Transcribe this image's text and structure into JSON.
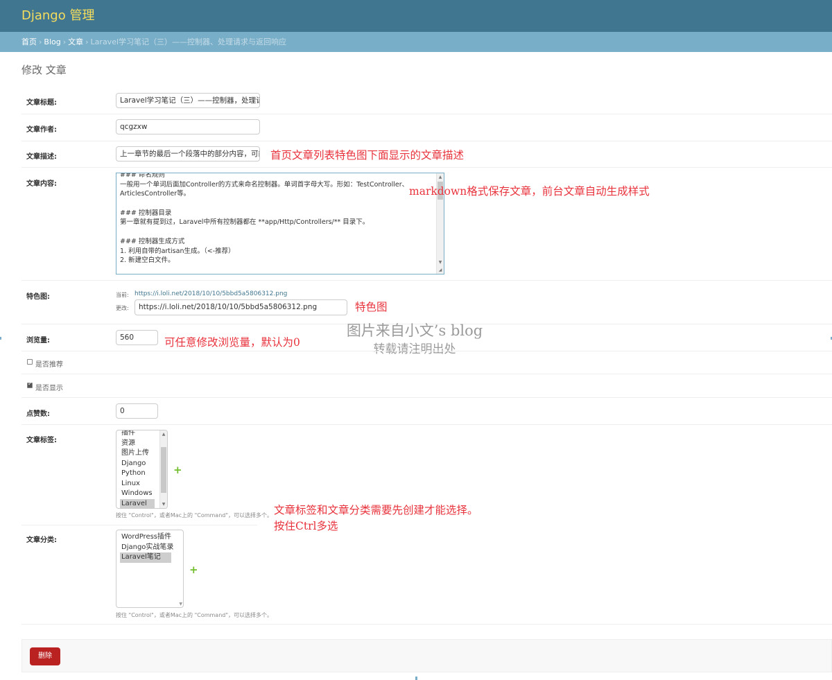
{
  "header": {
    "site_name": "Django 管理"
  },
  "breadcrumbs": {
    "home": "首页",
    "app": "Blog",
    "model": "文章",
    "current": "Laravel学习笔记（三）——控制器、处理请求与返回响应",
    "separator": "›"
  },
  "page": {
    "title": "修改 文章"
  },
  "fields": {
    "title": {
      "label": "文章标题:",
      "value": "Laravel学习笔记（三）——控制器，处理请求"
    },
    "author": {
      "label": "文章作者:",
      "value": "qcgzxw"
    },
    "description": {
      "label": "文章描述:",
      "value": "上一章节的最后一个段落中的部分内容，可能"
    },
    "content": {
      "label": "文章内容:",
      "lines": [
        "### 命名规则",
        "一般用一个单词后面加Controller的方式来命名控制器。单词首字母大写。形如：TestController、",
        "ArticlesController等。",
        "",
        "### 控制器目录",
        "第一章就有提到过，Laravel中所有控制器都在 **app/Http/Controllers/** 目录下。",
        "",
        "### 控制器生成方式",
        "1. 利用自带的artisan生成。（<-推荐）",
        "2. 新建空白文件。"
      ]
    },
    "image": {
      "label": "特色图:",
      "current_label": "当前:",
      "current_url": "https://i.loli.net/2018/10/10/5bbd5a5806312.png",
      "change_label": "更改:",
      "value": "https://i.loli.net/2018/10/10/5bbd5a5806312.png"
    },
    "views": {
      "label": "浏览量:",
      "value": "560"
    },
    "recommended": {
      "label": "是否推荐",
      "checked": false
    },
    "visible": {
      "label": "是否显示",
      "checked": true
    },
    "likes": {
      "label": "点赞数:",
      "value": "0"
    },
    "tags": {
      "label": "文章标签:",
      "options": [
        "插件",
        "资源",
        "图片上传",
        "Django",
        "Python",
        "Linux",
        "Windows",
        "Laravel"
      ],
      "selected": "Laravel",
      "help": "按住 \"Control\"，或者Mac上的 \"Command\"，可以选择多个。"
    },
    "categories": {
      "label": "文章分类:",
      "options": [
        "WordPress插件",
        "Django实战笔录",
        "Laravel笔记"
      ],
      "selected": "Laravel笔记",
      "help": "按住 \"Control\"，或者Mac上的 \"Command\"，可以选择多个。"
    }
  },
  "annotations": {
    "description": "首页文章列表特色图下面显示的文章描述",
    "content": "markdown格式保存文章，前台文章自动生成样式",
    "image": "特色图",
    "views": "可任意修改浏览量，默认为0",
    "tags_line1": "文章标签和文章分类需要先创建才能选择。",
    "tags_line2": "按住Ctrl多选"
  },
  "watermark": {
    "line1": "图片来自小文’s blog",
    "line2": "转载请注明出处"
  },
  "actions": {
    "delete_label": "删除"
  },
  "icons": {
    "add": "plus-icon",
    "scroll_up": "arrow-up-icon",
    "scroll_down": "arrow-down-icon"
  },
  "colors": {
    "header": "#417690",
    "breadcrumbs": "#79aec8",
    "site_name": "#f5dd5d",
    "delete": "#ba2121",
    "add": "#70bf2b",
    "annotation": "#e8333d"
  }
}
